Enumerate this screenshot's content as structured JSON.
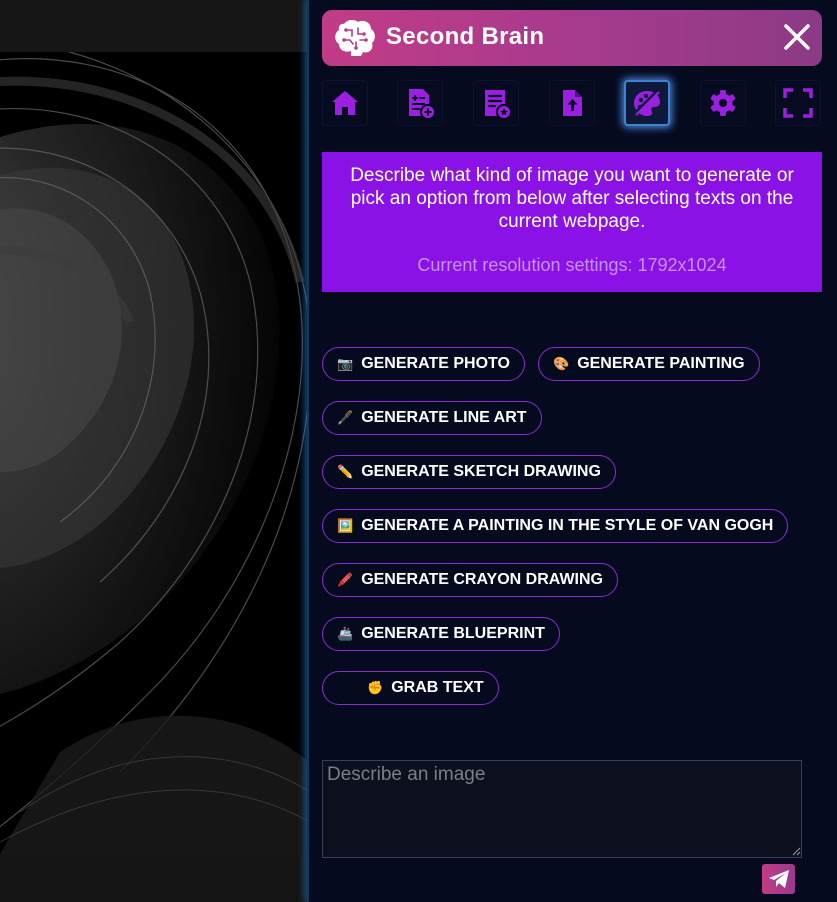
{
  "header": {
    "title": "Second Brain"
  },
  "toolbar": {
    "items": [
      {
        "icon": "home-icon"
      },
      {
        "icon": "document-add-icon"
      },
      {
        "icon": "document-star-icon"
      },
      {
        "icon": "file-upload-icon"
      },
      {
        "icon": "palette-icon",
        "active": true
      },
      {
        "icon": "gear-icon"
      },
      {
        "icon": "fullscreen-icon"
      }
    ]
  },
  "info": {
    "description": "Describe what kind of image you want to generate or pick an option from below after selecting texts on the current webpage.",
    "resolution": "Current resolution settings: 1792x1024"
  },
  "options": [
    {
      "emoji": "📷",
      "label": "GENERATE PHOTO"
    },
    {
      "emoji": "🎨",
      "label": "GENERATE PAINTING"
    },
    {
      "emoji": "🖋️",
      "label": "GENERATE LINE ART"
    },
    {
      "emoji": "✏️",
      "label": "GENERATE SKETCH DRAWING"
    },
    {
      "emoji": "🖼️",
      "label": "GENERATE A PAINTING IN THE STYLE OF VAN GOGH"
    },
    {
      "emoji": "🖍️",
      "label": "GENERATE CRAYON DRAWING"
    },
    {
      "emoji": "🚢",
      "label": "GENERATE BLUEPRINT"
    },
    {
      "emoji": "✊",
      "label": "GRAB TEXT"
    }
  ],
  "input": {
    "placeholder": "Describe an image",
    "value": ""
  },
  "colors": {
    "panel": "#050a1f",
    "accent": "#8b12e6",
    "header_start": "#c13c86",
    "header_end": "#8c3a86",
    "chip_border": "#8b2bd6",
    "tool_icon": "#9b1fe0"
  }
}
